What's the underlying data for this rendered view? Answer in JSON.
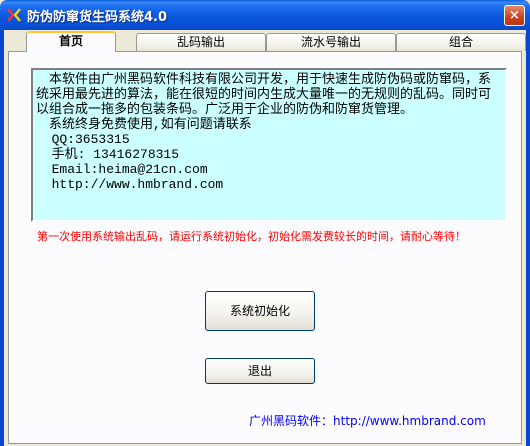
{
  "window": {
    "title": "防伪防窜货生码系统4.0",
    "close_label": "×"
  },
  "tabs": [
    {
      "label": "首页",
      "active": true
    },
    {
      "label": "乱码输出",
      "active": false
    },
    {
      "label": "流水号输出",
      "active": false
    },
    {
      "label": "组合",
      "active": false
    }
  ],
  "intro": {
    "paragraph": "本软件由广州黑码软件科技有限公司开发，用于快速生成防伪码或防窜码，系统采用最先进的算法，能在很短的时间内生成大量唯一的无规则的乱码。同时可以组合成一拖多的包装条码。广泛用于企业的防伪和防窜货管理。",
    "contact_lead": "系统终身免费使用,如有问题请联系",
    "qq": "  QQ:3653315",
    "phone": "  手机: 13416278315",
    "email": "  Email:heima@21cn.com",
    "website": "  http://www.hmbrand.com"
  },
  "warning": "第一次使用系统输出乱码，请运行系统初始化，初始化需发费较长的时间，请耐心等待！",
  "buttons": {
    "init": "系统初始化",
    "exit": "退出"
  },
  "footer": {
    "label": "广州黑码软件：",
    "link": "http://www.hmbrand.com"
  },
  "colors": {
    "intro_bg": "#ccffff",
    "warning": "#ff0000",
    "footer_link": "#0000ff",
    "titlebar": "#0a58dc"
  }
}
